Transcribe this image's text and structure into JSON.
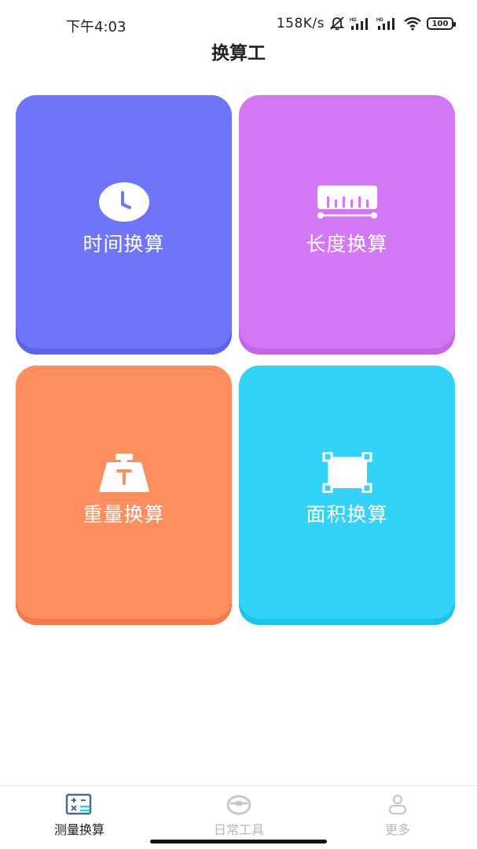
{
  "status_bar": {
    "time": "下午4:03",
    "network_speed": "158K/s",
    "battery": "100"
  },
  "header": {
    "title": "换算工"
  },
  "cards": [
    {
      "label": "时间换算",
      "icon": "clock-icon",
      "color": "#6f75f9"
    },
    {
      "label": "长度换算",
      "icon": "ruler-icon",
      "color": "#d477f4"
    },
    {
      "label": "重量换算",
      "icon": "weight-icon",
      "color": "#fe8d5f"
    },
    {
      "label": "面积换算",
      "icon": "area-icon",
      "color": "#32d3f7"
    }
  ],
  "bottom_nav": {
    "items": [
      {
        "label": "测量换算",
        "icon": "calculator-icon",
        "active": true
      },
      {
        "label": "日常工具",
        "icon": "toolbox-icon",
        "active": false
      },
      {
        "label": "更多",
        "icon": "user-icon",
        "active": false
      }
    ]
  }
}
